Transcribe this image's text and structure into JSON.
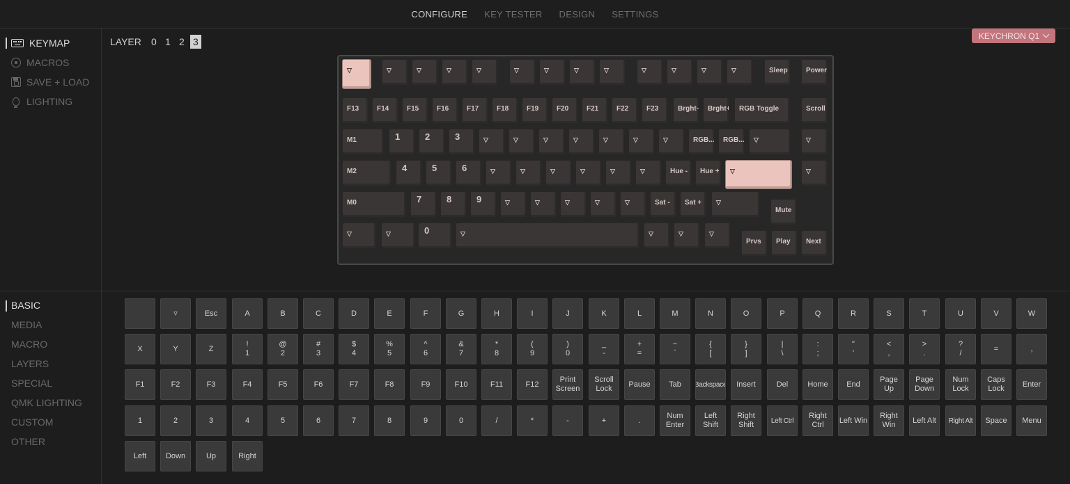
{
  "nav": {
    "tabs": [
      "CONFIGURE",
      "KEY TESTER",
      "DESIGN",
      "SETTINGS"
    ],
    "active": 0
  },
  "sidebar_top": {
    "items": [
      {
        "label": "KEYMAP",
        "icon": "keyboard-icon",
        "active": true
      },
      {
        "label": "MACROS",
        "icon": "macro-icon",
        "active": false
      },
      {
        "label": "SAVE + LOAD",
        "icon": "save-icon",
        "active": false
      },
      {
        "label": "LIGHTING",
        "icon": "bulb-icon",
        "active": false
      }
    ]
  },
  "sidebar_bottom": {
    "items": [
      "BASIC",
      "MEDIA",
      "MACRO",
      "LAYERS",
      "SPECIAL",
      "QMK LIGHTING",
      "CUSTOM",
      "OTHER"
    ],
    "active": 0
  },
  "layers": {
    "label": "LAYER",
    "options": [
      "0",
      "1",
      "2",
      "3"
    ],
    "active": 3
  },
  "device": {
    "label": "KEYCHRON Q1"
  },
  "keyboard": {
    "accent": "#ebc5bd",
    "rows": [
      [
        "▽",
        "▽",
        "▽",
        "▽",
        "▽",
        "▽",
        "▽",
        "▽",
        "▽",
        "▽",
        "▽",
        "▽",
        "▽",
        "Sleep",
        "Power"
      ],
      [
        "F13",
        "F14",
        "F15",
        "F16",
        "F17",
        "F18",
        "F19",
        "F20",
        "F21",
        "F22",
        "F23",
        "Brght-",
        "Brght+",
        "RGB Toggle",
        "Scroll"
      ],
      [
        "M1",
        "1",
        "2",
        "3",
        "▽",
        "▽",
        "▽",
        "▽",
        "▽",
        "▽",
        "▽",
        "RGB...",
        "RGB...",
        "▽",
        "▽"
      ],
      [
        "M2",
        "4",
        "5",
        "6",
        "▽",
        "▽",
        "▽",
        "▽",
        "▽",
        "▽",
        "Hue -",
        "Hue +",
        "▽",
        "▽"
      ],
      [
        "M0",
        "7",
        "8",
        "9",
        "▽",
        "▽",
        "▽",
        "▽",
        "▽",
        "Sat -",
        "Sat +",
        "▽",
        "Mute"
      ],
      [
        "▽",
        "▽",
        "0",
        "▽",
        "▽",
        "▽",
        "▽",
        "Prvs",
        "Play",
        "Next"
      ]
    ]
  },
  "palette": {
    "keys": [
      "",
      "▿",
      "Esc",
      "A",
      "B",
      "C",
      "D",
      "E",
      "F",
      "G",
      "H",
      "I",
      "J",
      "K",
      "L",
      "M",
      "N",
      "O",
      "P",
      "Q",
      "R",
      "S",
      "T",
      "U",
      "V",
      "W",
      "X",
      "Y",
      "Z",
      "!\n1",
      "@\n2",
      "#\n3",
      "$\n4",
      "%\n5",
      "^\n6",
      "&\n7",
      "*\n8",
      "(\n9",
      ")\n0",
      "_\n-",
      "+\n=",
      "~\n`",
      "{\n[",
      "}\n]",
      "|\n\\",
      ":\n;",
      "\"\n'",
      "<\n,",
      ">\n.",
      "?\n/",
      "=",
      ",",
      "F1",
      "F2",
      "F3",
      "F4",
      "F5",
      "F6",
      "F7",
      "F8",
      "F9",
      "F10",
      "F11",
      "F12",
      "Print\nScreen",
      "Scroll\nLock",
      "Pause",
      "Tab",
      "Backspace",
      "Insert",
      "Del",
      "Home",
      "End",
      "Page Up",
      "Page\nDown",
      "Num\nLock",
      "Caps\nLock",
      "Enter",
      "1",
      "2",
      "3",
      "4",
      "5",
      "6",
      "7",
      "8",
      "9",
      "0",
      "/",
      "*",
      "-",
      "+",
      ".",
      "Num\nEnter",
      "Left\nShift",
      "Right\nShift",
      "Left Ctrl",
      "Right\nCtrl",
      "Left Win",
      "Right\nWin",
      "Left Alt",
      "Right Alt",
      "Space",
      "Menu",
      "Left",
      "Down",
      "Up",
      "Right"
    ]
  }
}
